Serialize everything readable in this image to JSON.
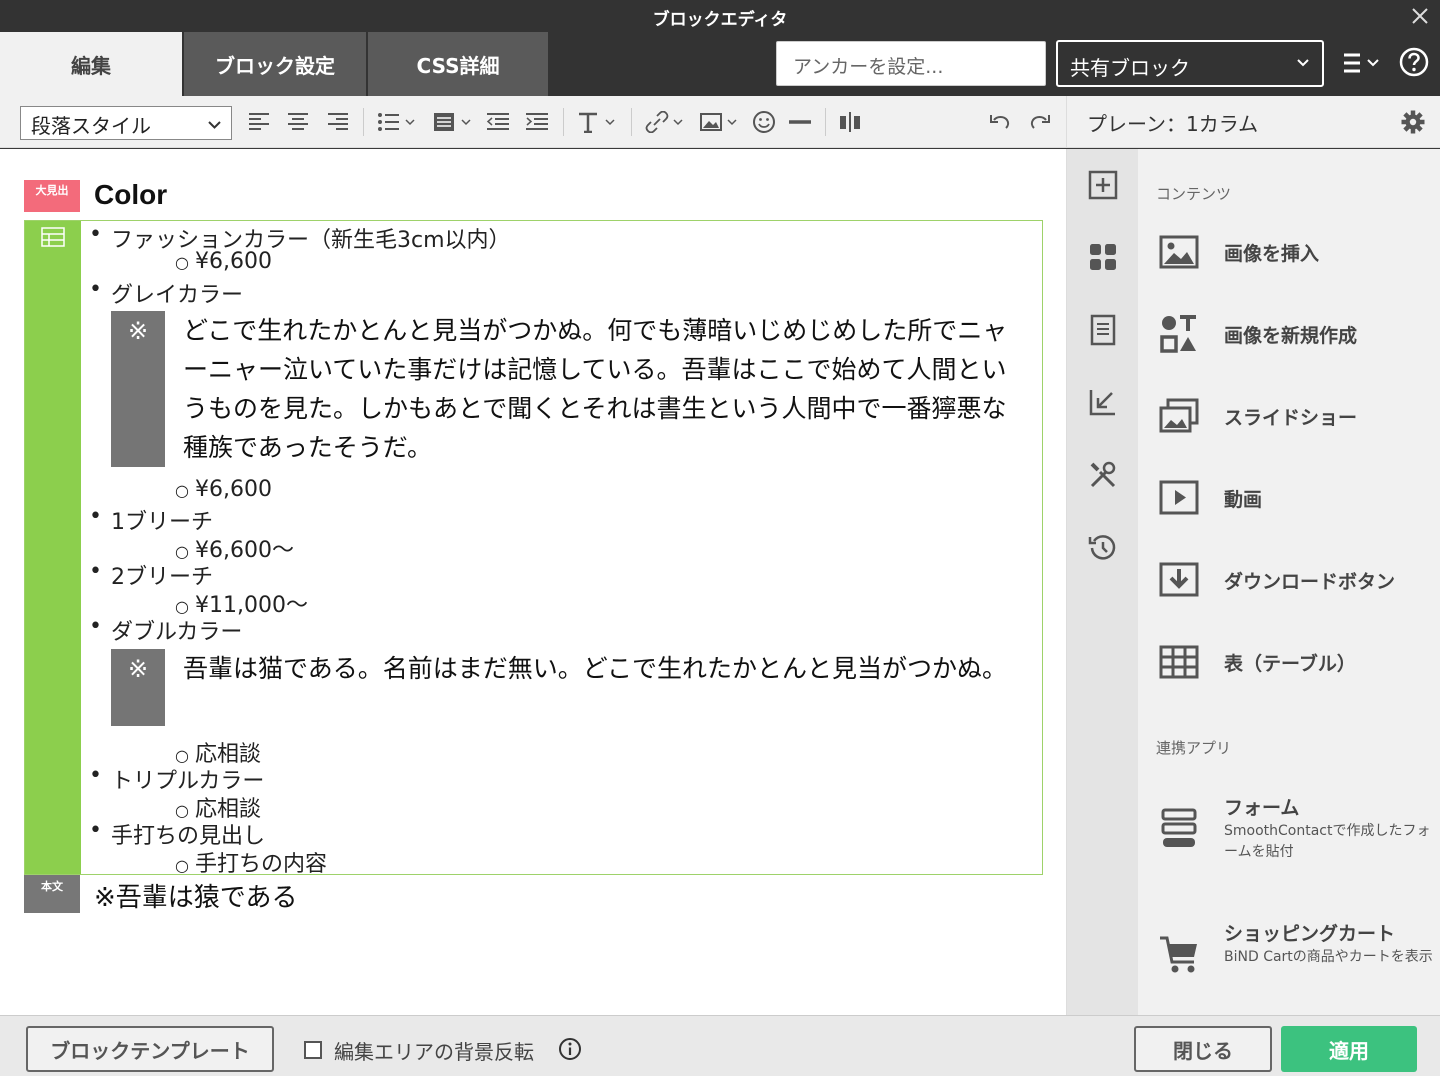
{
  "window": {
    "title": "ブロックエディタ"
  },
  "tabs": [
    {
      "label": "編集"
    },
    {
      "label": "ブロック設定"
    },
    {
      "label": "CSS詳細"
    }
  ],
  "header": {
    "anchor_placeholder": "アンカーを設定...",
    "shared_block": "共有ブロック"
  },
  "toolbar": {
    "paragraph_style": "段落スタイル"
  },
  "right_header": {
    "label": "プレーン：1カラム"
  },
  "editor": {
    "heading_tag": "大見出",
    "heading": "Color",
    "list": {
      "i1": "ファッションカラー（新生毛3cm以内）",
      "i1_sub": "¥6,600",
      "i2": "グレイカラー",
      "note1_mark": "※",
      "note1": "どこで生れたかとんと見当がつかぬ。何でも薄暗いじめじめした所でニャーニャー泣いていた事だけは記憶している。吾輩はここで始めて人間というものを見た。しかもあとで聞くとそれは書生という人間中で一番獰悪な種族であったそうだ。",
      "i2_sub": "¥6,600",
      "i3": "1ブリーチ",
      "i3_sub": "¥6,600〜",
      "i4": "2ブリーチ",
      "i4_sub": "¥11,000〜",
      "i5": "ダブルカラー",
      "note2_mark": "※",
      "note2": "吾輩は猫である。名前はまだ無い。どこで生れたかとんと見当がつかぬ。",
      "i5_sub": "応相談",
      "i6": "トリプルカラー",
      "i6_sub": "応相談",
      "i7": "手打ちの見出し",
      "i7_sub": "手打ちの内容"
    },
    "body_tag": "本文",
    "body_text": "※吾輩は猿である"
  },
  "panel": {
    "section_contents": "コンテンツ",
    "items": [
      {
        "label": "画像を挿入",
        "icon": "image-icon"
      },
      {
        "label": "画像を新規作成",
        "icon": "create-image-icon"
      },
      {
        "label": "スライドショー",
        "icon": "slideshow-icon"
      },
      {
        "label": "動画",
        "icon": "video-icon"
      },
      {
        "label": "ダウンロードボタン",
        "icon": "download-icon"
      },
      {
        "label": "表（テーブル）",
        "icon": "table-icon"
      }
    ],
    "section_apps": "連携アプリ",
    "apps": [
      {
        "label": "フォーム",
        "desc": "SmoothContactで作成したフォームを貼付",
        "icon": "form-icon"
      },
      {
        "label": "ショッピングカート",
        "desc": "BiND Cartの商品やカートを表示",
        "icon": "cart-icon"
      }
    ]
  },
  "footer": {
    "template_button": "ブロックテンプレート",
    "invert_label": "編集エリアの背景反転",
    "close_button": "閉じる",
    "apply_button": "適用"
  },
  "colors": {
    "heading_tag": "#f36b7b",
    "block_tag": "#8ccf4d",
    "apply": "#3cc27f"
  }
}
